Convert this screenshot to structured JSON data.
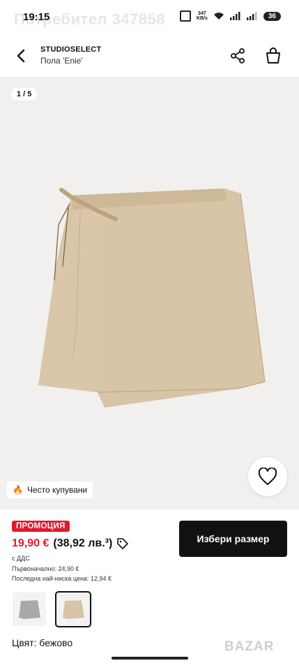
{
  "status": {
    "time": "19:15",
    "overlay_user": "Потребител 347858",
    "net_speed": "347\nKB/s",
    "battery": "36"
  },
  "header": {
    "brand": "STUDIOSELECT",
    "title": "Пола 'Enie'"
  },
  "gallery": {
    "counter": "1 / 5",
    "image_desc": "beige-wrap-skirt",
    "skirt_color": "#d9c6a8"
  },
  "badges": {
    "often_bought": "Често купувани"
  },
  "product": {
    "promo": "ПРОМОЦИЯ",
    "price_now": "19,90 €",
    "price_alt": "(38,92 лв.³)",
    "vat": "с ДДС",
    "original": "Първоначално: 24,90 €",
    "lowest": "Последна най-ниска цена: 12,94 €",
    "color_label": "Цвят: бежово"
  },
  "actions": {
    "choose_size": "Избери размер"
  },
  "watermark": "BAZAR",
  "colors": {
    "promo": "#e0192b",
    "button": "#111111"
  }
}
